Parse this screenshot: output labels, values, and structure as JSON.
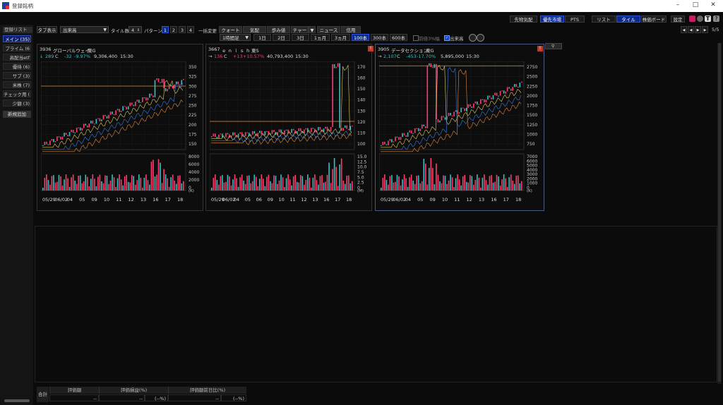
{
  "window": {
    "title": "登録銘柄"
  },
  "top_right": {
    "buttons": [
      "先物気配",
      "優先市場",
      "PTS",
      "リスト",
      "タイル",
      "株価ボード",
      "設定"
    ]
  },
  "toolbar": {
    "tab_display_label": "タブ表示",
    "sort_value": "出来高",
    "tile_count_label": "タイル数",
    "tile_count_value": "4",
    "pattern_label": "パターン",
    "patterns": [
      "1",
      "2",
      "3",
      "4"
    ],
    "bulk_change_label": "一括変更",
    "views": [
      "クォート",
      "気配",
      "歩み値",
      "チャート",
      "ニュース",
      "信用"
    ],
    "timeframe_value": "1時間足",
    "periods": [
      "1日",
      "2日",
      "3日",
      "1ヵ月",
      "3ヵ月",
      "100本",
      "300本",
      "600本"
    ],
    "stop_high_label": "前値3%幅",
    "volume_label": "出来高",
    "page_indicator": "5/5"
  },
  "sidebar": {
    "header": "登録リスト",
    "items": [
      "メイン (35)",
      "プライム (6",
      "高配当etf",
      "優待 (6)",
      "サブ (3)",
      "米株 (7)",
      "チェック用 (",
      "少額 (3)"
    ],
    "add_button": "新規追加"
  },
  "tiles": [
    {
      "code": "3936",
      "name": "グローバルウェイ",
      "market": "東G",
      "arrow": "↓",
      "price": "289",
      "price_flag": "C",
      "change": "-32",
      "change_pct": "-9.97%",
      "volume": "9,306,400",
      "time": "15:30",
      "y_ticks": [
        "350",
        "325",
        "300",
        "275",
        "250",
        "225",
        "200",
        "175",
        "150"
      ],
      "vol_ticks": [
        "8000",
        "6000",
        "4000",
        "2000",
        "0"
      ],
      "vol_unit": "(K)",
      "x_ticks": [
        "05/29",
        "06/02",
        "04",
        "05",
        "09",
        "10",
        "11",
        "12",
        "13",
        "16",
        "17",
        "18"
      ]
    },
    {
      "code": "3667",
      "name": "ｅｎｉｓｈ",
      "market": "東S",
      "arrow": "→",
      "price": "136",
      "price_flag": "C",
      "change": "+13",
      "change_pct": "+10.57%",
      "volume": "40,793,400",
      "time": "15:30",
      "y_ticks": [
        "170",
        "160",
        "150",
        "140",
        "130",
        "120",
        "110",
        "100"
      ],
      "vol_ticks": [
        "15.0",
        "12.5",
        "10.0",
        "7.5",
        "5.0",
        "2.5",
        "0"
      ],
      "vol_unit": "(M)",
      "x_ticks": [
        "05/29",
        "06/02",
        "04",
        "05",
        "06",
        "09",
        "10",
        "11",
        "12",
        "13",
        "16",
        "17",
        "18"
      ]
    },
    {
      "code": "3905",
      "name": "データセクション",
      "market": "東G",
      "arrow": "→",
      "price": "2,107",
      "price_flag": "C",
      "change": "-453",
      "change_pct": "-17.70%",
      "volume": "5,895,000",
      "time": "15:30",
      "y_ticks": [
        "2750",
        "2500",
        "2250",
        "2000",
        "1750",
        "1500",
        "1250",
        "1000",
        "750"
      ],
      "vol_ticks": [
        "7000",
        "6000",
        "5000",
        "4000",
        "3000",
        "2000",
        "1000",
        "0"
      ],
      "vol_unit": "(K)",
      "x_ticks": [
        "05/29",
        "06/02",
        "04",
        "05",
        "09",
        "10",
        "11",
        "12",
        "13",
        "16",
        "17",
        "18"
      ]
    }
  ],
  "footer": {
    "total_label": "合計",
    "headers": [
      "評価額",
      "評価損益(%)",
      "評価額前日比(%)"
    ],
    "values": [
      "--",
      "--",
      "(--%)",
      "--",
      "(--%)"
    ]
  },
  "colors": {
    "accent": "#0d2a8a",
    "up": "#ff3d6e",
    "down": "#2ec3c7"
  }
}
